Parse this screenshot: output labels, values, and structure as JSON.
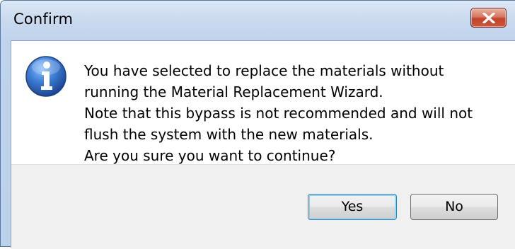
{
  "window": {
    "title": "Confirm",
    "close_icon": "close-icon"
  },
  "dialog": {
    "icon": "info-icon",
    "message_lines": [
      "You have selected to replace the materials without",
      "running the Material Replacement Wizard.",
      "Note that this bypass is not recommended and will not",
      "flush the system with the new materials.",
      "Are you sure you want to continue?"
    ]
  },
  "buttons": {
    "yes_label": "Yes",
    "no_label": "No"
  },
  "colors": {
    "title_bar": "#c8d9ee",
    "close_button": "#c4432c",
    "info_icon": "#2a5fb0",
    "button_bar": "#f0f0f0",
    "default_button_border": "#3c7fb1"
  }
}
